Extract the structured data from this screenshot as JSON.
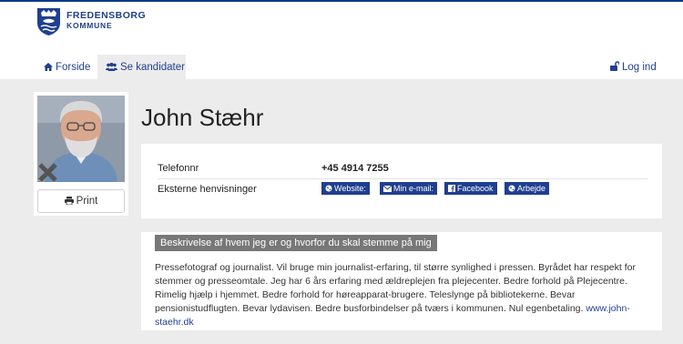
{
  "brand": {
    "line1": "FREDENSBORG",
    "line2": "KOMMUNE",
    "color": "#1f3f8f"
  },
  "nav": {
    "items": [
      {
        "label": "Forside",
        "icon": "home-icon"
      },
      {
        "label": "Se kandidater",
        "icon": "users-icon"
      }
    ],
    "login": {
      "label": "Log ind",
      "icon": "unlock-icon"
    }
  },
  "sidebar": {
    "print_label": "Print",
    "print_icon": "print-icon"
  },
  "candidate": {
    "name": "John Stæhr",
    "phone_label": "Telefonnr",
    "phone": "+45 4914 7255",
    "links_label": "Eksterne henvisninger",
    "links": [
      {
        "label": "Website:",
        "icon": "globe-icon"
      },
      {
        "label": "Min e-mail:",
        "icon": "envelope-icon"
      },
      {
        "label": "Facebook",
        "icon": "facebook-icon"
      },
      {
        "label": "Arbejde",
        "icon": "globe-icon"
      }
    ]
  },
  "description": {
    "title": "Beskrivelse af hvem jeg er og hvorfor du skal stemme på mig",
    "text": "Pressefotograf og journalist. Vil bruge min journalist-erfaring, til større synlighed i pressen. Byrådet har respekt for stemmer og presseomtale. Jeg har 6 års erfaring med ældreplejen fra plejecenter. Bedre forhold på Plejecentre. Rimelig hjælp i hjemmet. Bedre forhold for høreapparat-brugere. Teleslynge på bibliotekerne. Bevar pensionistudflugten. Bevar lydavisen. Bedre busforbindelser på tværs i kommunen. Nul egenbetaling.",
    "link": "www.john-staehr.dk"
  }
}
